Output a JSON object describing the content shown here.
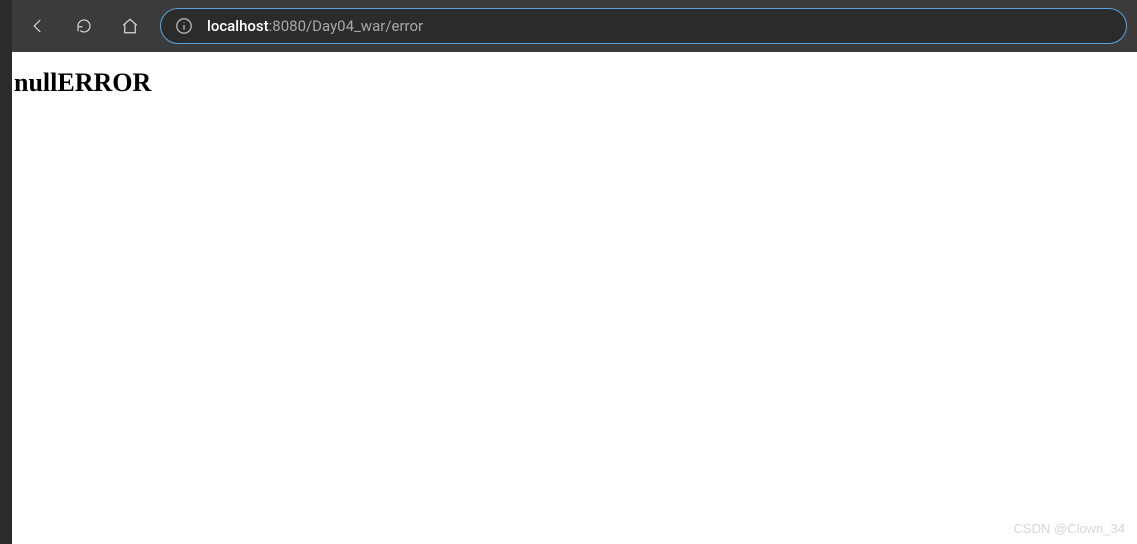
{
  "toolbar": {
    "url_host": "localhost",
    "url_rest": ":8080/Day04_war/error"
  },
  "page": {
    "heading": "nullERROR"
  },
  "watermark": {
    "text": "CSDN @Clown_34"
  }
}
